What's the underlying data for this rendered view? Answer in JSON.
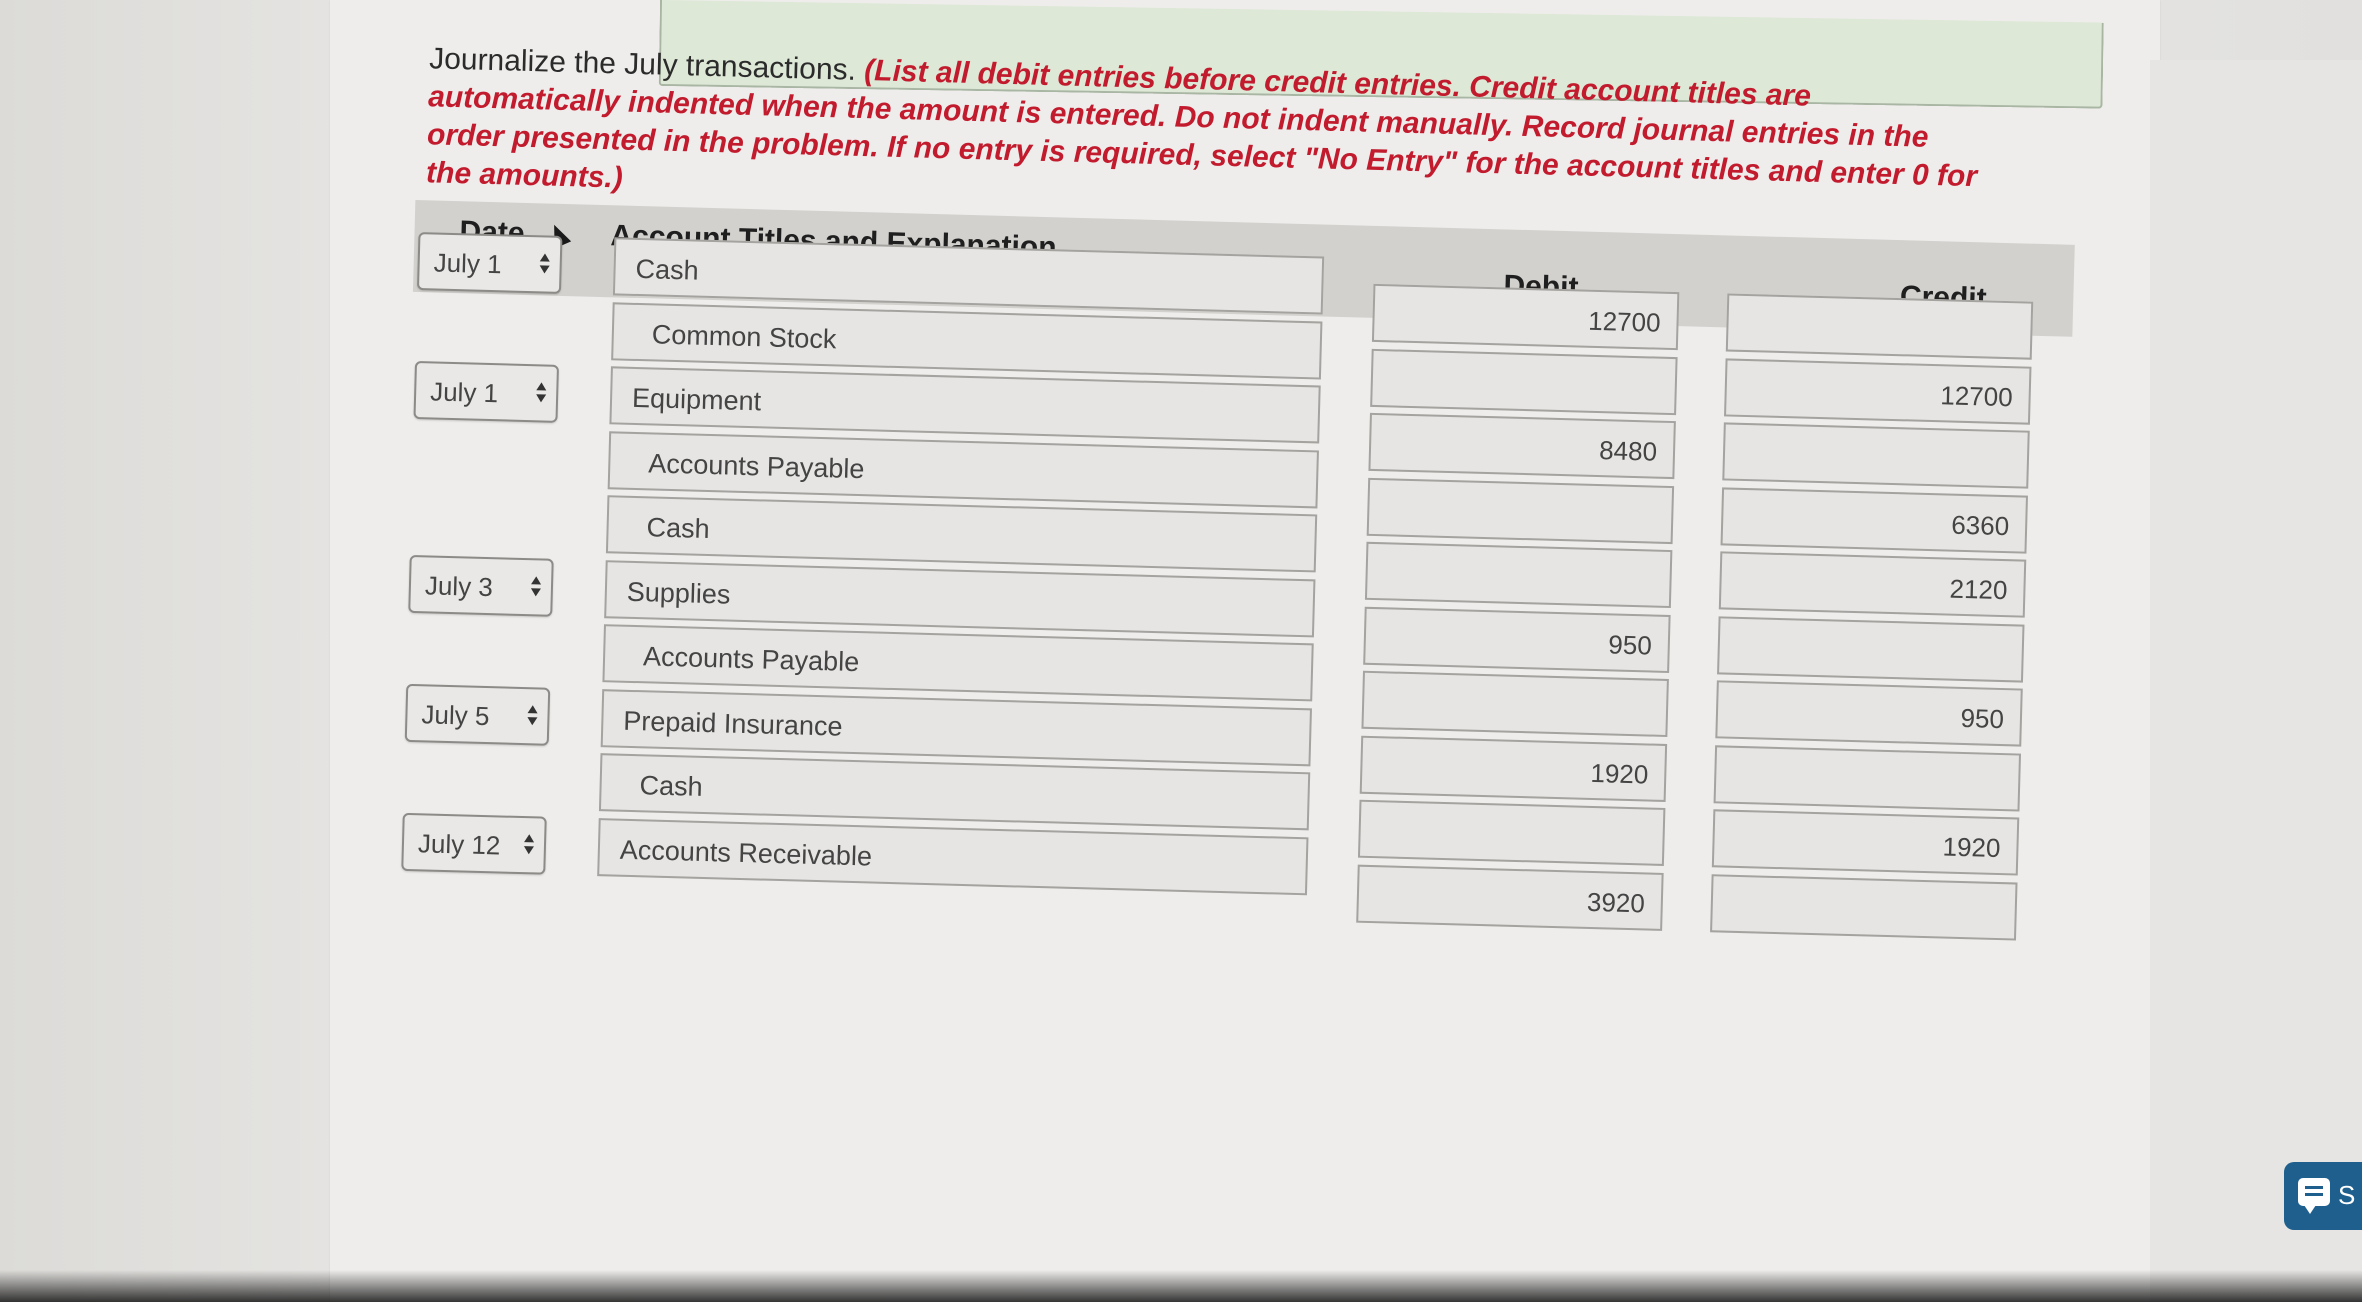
{
  "instructions": {
    "lead": "Journalize the July transactions. ",
    "emphasis": "(List all debit entries before credit entries. Credit account titles are automatically indented when the amount is entered. Do not indent manually. Record journal entries in the order presented in the problem. If no entry is required, select \"No Entry\" for the account titles and enter 0 for the amounts.)"
  },
  "table": {
    "headers": {
      "date": "Date",
      "account": "Account Titles and Explanation",
      "debit": "Debit",
      "credit": "Credit"
    },
    "rows": [
      {
        "date": "July 1",
        "account": "Cash",
        "debit": "12700",
        "credit": ""
      },
      {
        "date": "",
        "account": "Common Stock",
        "debit": "",
        "credit": "12700"
      },
      {
        "date": "July 1",
        "account": "Equipment",
        "debit": "8480",
        "credit": ""
      },
      {
        "date": "",
        "account": "Accounts Payable",
        "debit": "",
        "credit": "6360"
      },
      {
        "date": "",
        "account": "Cash",
        "debit": "",
        "credit": "2120"
      },
      {
        "date": "July 3",
        "account": "Supplies",
        "debit": "950",
        "credit": ""
      },
      {
        "date": "",
        "account": "Accounts Payable",
        "debit": "",
        "credit": "950"
      },
      {
        "date": "July 5",
        "account": "Prepaid Insurance",
        "debit": "1920",
        "credit": ""
      },
      {
        "date": "",
        "account": "Cash",
        "debit": "",
        "credit": "1920"
      },
      {
        "date": "July 12",
        "account": "Accounts Receivable",
        "debit": "3920",
        "credit": ""
      }
    ]
  },
  "chat_widget": {
    "label": "S"
  },
  "colors": {
    "emphasis": "#c21b2e",
    "header_bg": "#d2d1ce",
    "chat_bg": "#1e5f8e"
  }
}
